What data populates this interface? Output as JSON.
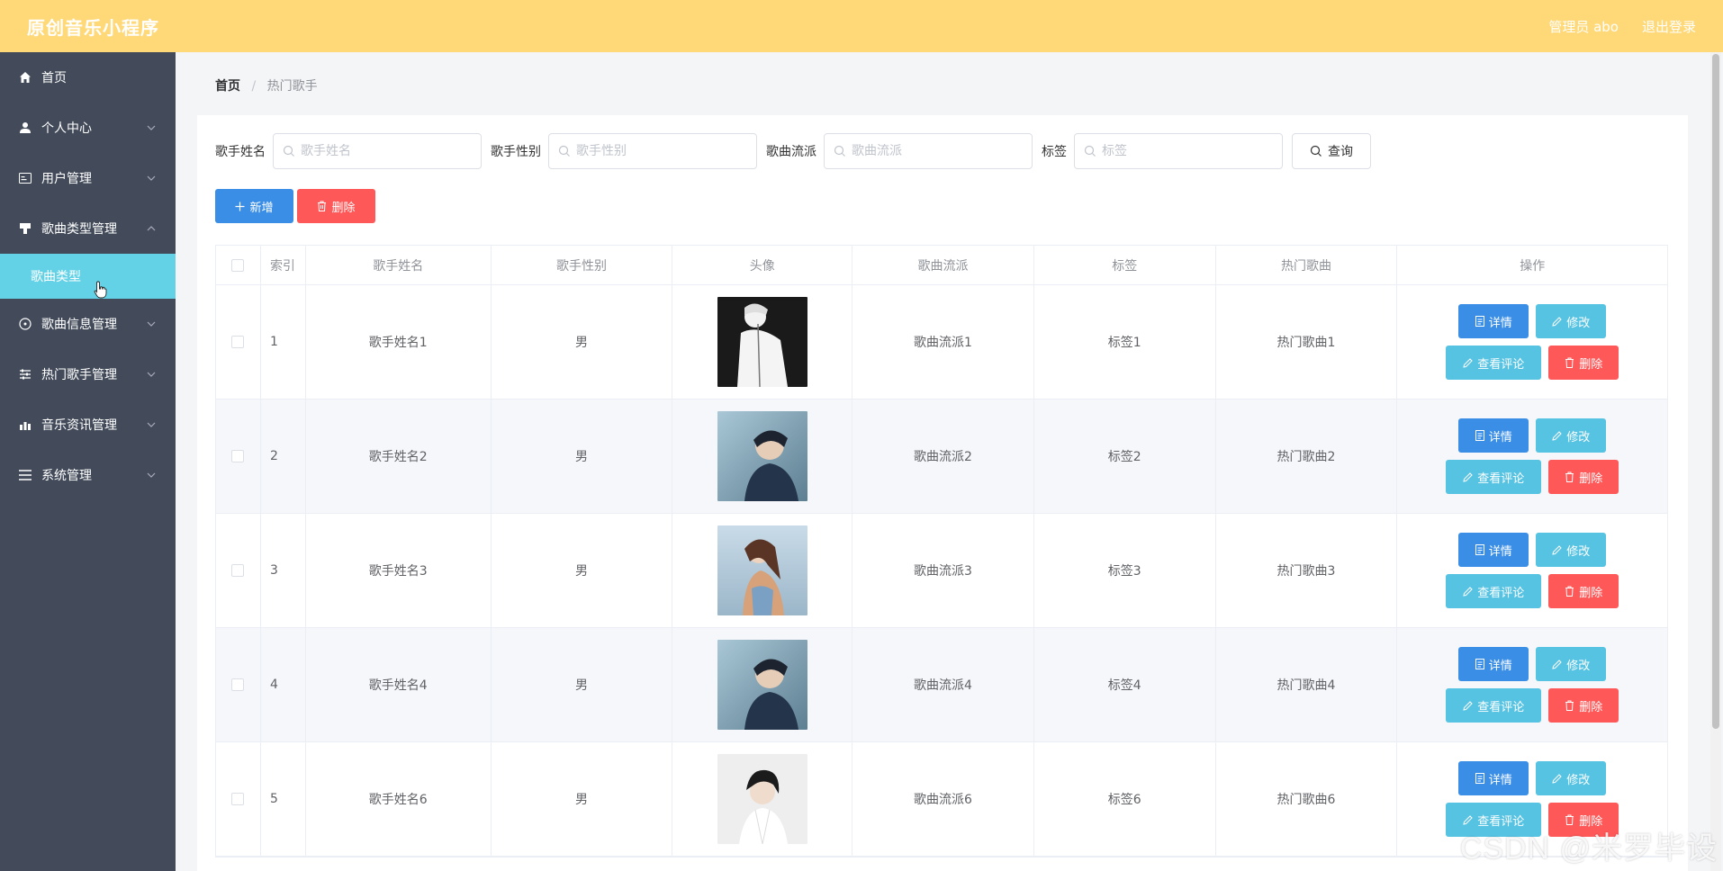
{
  "header": {
    "app_title": "原创音乐小程序",
    "admin_label": "管理员 abo",
    "logout_label": "退出登录"
  },
  "sidebar": {
    "items": [
      {
        "label": "首页",
        "icon": "home-icon"
      },
      {
        "label": "个人中心",
        "icon": "user-icon"
      },
      {
        "label": "用户管理",
        "icon": "id-card-icon"
      },
      {
        "label": "歌曲类型管理",
        "icon": "stamp-icon"
      },
      {
        "label": "歌曲信息管理",
        "icon": "compass-icon"
      },
      {
        "label": "热门歌手管理",
        "icon": "sliders-icon"
      },
      {
        "label": "音乐资讯管理",
        "icon": "chart-icon"
      },
      {
        "label": "系统管理",
        "icon": "menu-icon"
      }
    ],
    "submenu": {
      "label": "歌曲类型"
    }
  },
  "breadcrumb": {
    "home": "首页",
    "separator": "/",
    "current": "热门歌手"
  },
  "search": {
    "name_label": "歌手姓名",
    "name_placeholder": "歌手姓名",
    "gender_label": "歌手性别",
    "gender_placeholder": "歌手性别",
    "genre_label": "歌曲流派",
    "genre_placeholder": "歌曲流派",
    "tag_label": "标签",
    "tag_placeholder": "标签",
    "query_label": "查询"
  },
  "actions": {
    "add_label": "新增",
    "delete_label": "删除"
  },
  "table": {
    "headers": {
      "index": "索引",
      "name": "歌手姓名",
      "gender": "歌手性别",
      "avatar": "头像",
      "genre": "歌曲流派",
      "tag": "标签",
      "song": "热门歌曲",
      "ops": "操作"
    },
    "ops": {
      "detail": "详情",
      "edit": "修改",
      "comments": "查看评论",
      "delete": "删除"
    },
    "rows": [
      {
        "index": "1",
        "name": "歌手姓名1",
        "gender": "男",
        "genre": "歌曲流派1",
        "tag": "标签1",
        "song": "热门歌曲1"
      },
      {
        "index": "2",
        "name": "歌手姓名2",
        "gender": "男",
        "genre": "歌曲流派2",
        "tag": "标签2",
        "song": "热门歌曲2"
      },
      {
        "index": "3",
        "name": "歌手姓名3",
        "gender": "男",
        "genre": "歌曲流派3",
        "tag": "标签3",
        "song": "热门歌曲3"
      },
      {
        "index": "4",
        "name": "歌手姓名4",
        "gender": "男",
        "genre": "歌曲流派4",
        "tag": "标签4",
        "song": "热门歌曲4"
      },
      {
        "index": "5",
        "name": "歌手姓名6",
        "gender": "男",
        "genre": "歌曲流派6",
        "tag": "标签6",
        "song": "热门歌曲6"
      }
    ]
  },
  "watermark": "CSDN @米罗毕设",
  "colors": {
    "header": "#ffd878",
    "sidebar": "#434b5a",
    "active_submenu": "#63d2e6",
    "primary": "#3a8ee6",
    "info": "#56c3e3",
    "danger": "#ff5858"
  }
}
